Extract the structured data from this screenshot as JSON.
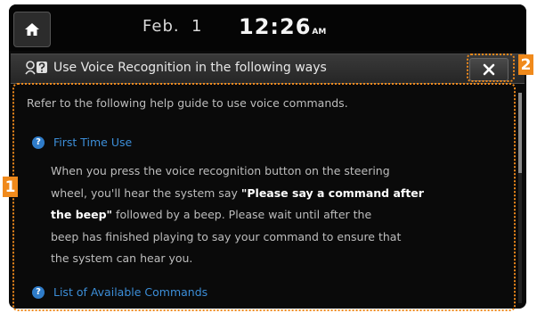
{
  "status_bar": {
    "date": "Feb.  1",
    "time": "12:26",
    "ampm": "AM"
  },
  "dialog": {
    "title": "Use Voice Recognition in the following ways",
    "intro": "Refer to the following help guide to use voice commands.",
    "sections": [
      {
        "heading": "First Time Use",
        "lines": [
          {
            "parts": [
              {
                "text": "When you press the voice recognition button on the steering"
              }
            ]
          },
          {
            "parts": [
              {
                "text": "wheel, you'll hear the system say "
              },
              {
                "text": "\"Please say a command after",
                "emphasis": true
              }
            ]
          },
          {
            "parts": [
              {
                "text": "the beep\"",
                "emphasis": true
              },
              {
                "text": " followed by a beep. Please wait until after the"
              }
            ]
          },
          {
            "parts": [
              {
                "text": "beep has finished playing to say your command to ensure that"
              }
            ]
          },
          {
            "parts": [
              {
                "text": "the system can hear you."
              }
            ]
          }
        ]
      },
      {
        "heading": "List of Available Commands"
      }
    ],
    "question_glyph": "?"
  },
  "callouts": {
    "content_area": "1",
    "close_button": "2"
  },
  "icons": {
    "home": "home-icon",
    "voice": "voice-help-icon",
    "close": "close-icon",
    "help": "question-icon"
  },
  "colors": {
    "accent_link": "#3c8ed8",
    "callout": "#f08a1c",
    "screen_bg": "#0a0a0a",
    "emphasis_text": "#ffffff"
  }
}
